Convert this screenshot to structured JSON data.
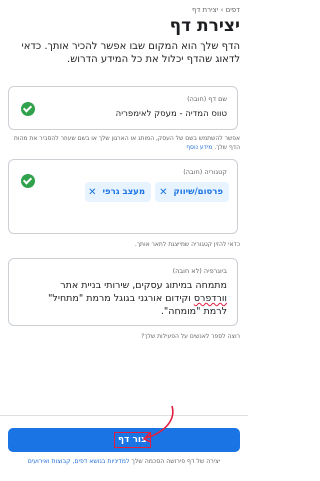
{
  "breadcrumb": "דפים › יצירת דף",
  "title": "יצירת דף",
  "intro": "הדף שלך הוא המקום שבו אפשר להכיר אותך. כדאי לדאוג שהדף יכלול את כל המידע הדרוש.",
  "page_name": {
    "label": "שם דף (חובה)",
    "value": "טווס המדיה - מעסק לאימפריה",
    "status_icon": "check-circle-icon",
    "help_text": "אפשר להשתמש בשם של העסק, המותג או הארגון שלך או בשם שעוזר להסביר את מהות הדף שלך.",
    "help_link": "מידע נוסף"
  },
  "category": {
    "label": "קטגוריה (חובה)",
    "chips": [
      {
        "label": "פרסום/שיווק",
        "remove_icon": "close-icon"
      },
      {
        "label": "מעצב גרפי",
        "remove_icon": "close-icon"
      }
    ],
    "status_icon": "check-circle-icon",
    "help_text": "כדאי להזין קטגוריה שמייצגת לתאר אותך."
  },
  "bio": {
    "label": "ביוגרפיה (לא חובה)",
    "line1": "מתמחה במיתוג עסקים, שירותי בניית אתר",
    "line2_misspelled": "וורדפרס",
    "line2_rest": " וקידום אורגני בגוגל מרמת \"מתחיל\"",
    "line3": "לרמת \"מומחה\".",
    "help_text": "רוצה לספר לאנשים על הפעילות שלך?"
  },
  "footer": {
    "create_button": "צור דף",
    "terms_prefix": "יצירה של דף פירושה הסכמה שלך ",
    "terms_link": "למדיניות בנושא דפים, קבוצות ואירועים"
  },
  "colors": {
    "primary": "#1b74e4",
    "success": "#31a24c",
    "annotation": "#e41e3f"
  }
}
